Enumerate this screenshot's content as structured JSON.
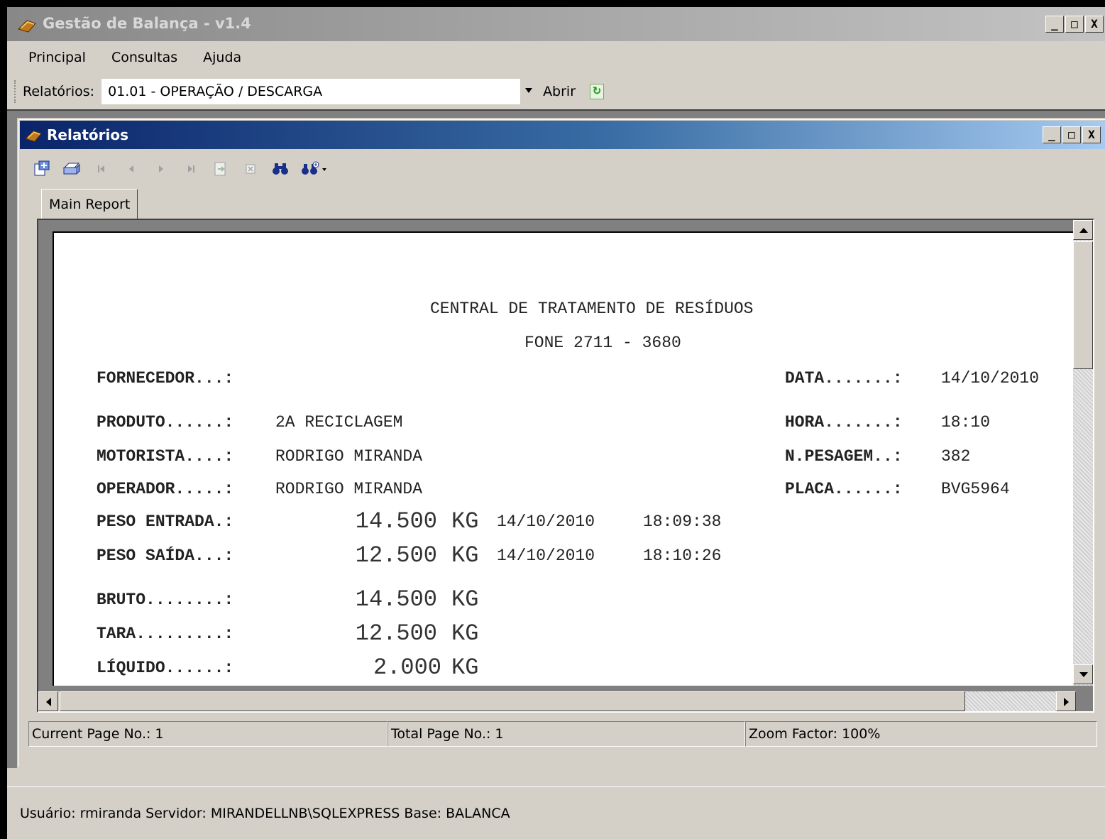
{
  "window": {
    "title": "Gestão de Balança - v1.4",
    "minimize": "_",
    "maximize": "□",
    "close": "X"
  },
  "menu": {
    "items": [
      {
        "label": "Principal"
      },
      {
        "label": "Consultas"
      },
      {
        "label": "Ajuda"
      }
    ]
  },
  "report_bar": {
    "label": "Relatórios:",
    "selected": "01.01 - OPERAÇÃO / DESCARGA",
    "open_label": "Abrir"
  },
  "child_window": {
    "title": "Relatórios",
    "minimize": "_",
    "maximize": "□",
    "close": "X"
  },
  "viewer": {
    "tab_label": "Main Report",
    "toolbar_icons": [
      "export-icon",
      "print-icon",
      "first-page-icon",
      "previous-page-icon",
      "next-page-icon",
      "last-page-icon",
      "goto-page-icon",
      "close-view-icon",
      "search-icon",
      "zoom-icon"
    ],
    "status": {
      "current_page": "Current Page No.: 1",
      "total_page": "Total Page No.: 1",
      "zoom": "Zoom Factor: 100%"
    }
  },
  "report": {
    "header_line1": "CENTRAL DE TRATAMENTO DE RESÍDUOS",
    "header_line2": "FONE 2711 - 3680",
    "fornecedor_label": "FORNECEDOR...:",
    "fornecedor_value": "",
    "data_label": "DATA.......:",
    "data_value": "14/10/2010",
    "produto_label": "PRODUTO......:",
    "produto_value": "2A RECICLAGEM",
    "hora_label": "HORA.......:",
    "hora_value": "18:10",
    "motorista_label": "MOTORISTA....:",
    "motorista_value": "RODRIGO MIRANDA",
    "pesagem_label": "N.PESAGEM..:",
    "pesagem_value": "382",
    "operador_label": "OPERADOR.....:",
    "operador_value": "RODRIGO MIRANDA",
    "placa_label": "PLACA......:",
    "placa_value": "BVG5964",
    "peso_entrada_label": "PESO ENTRADA.:",
    "peso_entrada_value": "14.500",
    "peso_entrada_unit": "KG",
    "peso_entrada_date": "14/10/2010",
    "peso_entrada_time": "18:09:38",
    "peso_saida_label": "PESO SAÍDA...:",
    "peso_saida_value": "12.500",
    "peso_saida_unit": "KG",
    "peso_saida_date": "14/10/2010",
    "peso_saida_time": "18:10:26",
    "bruto_label": "BRUTO........:",
    "bruto_value": "14.500",
    "bruto_unit": "KG",
    "tara_label": "TARA.........:",
    "tara_value": "12.500",
    "tara_unit": "KG",
    "liquido_label": "LÍQUIDO......:",
    "liquido_value": "2.000",
    "liquido_unit": "KG"
  },
  "app_status": {
    "text": "Usuário: rmiranda  Servidor: MIRANDELLNB\\SQLEXPRESS  Base: BALANCA"
  }
}
